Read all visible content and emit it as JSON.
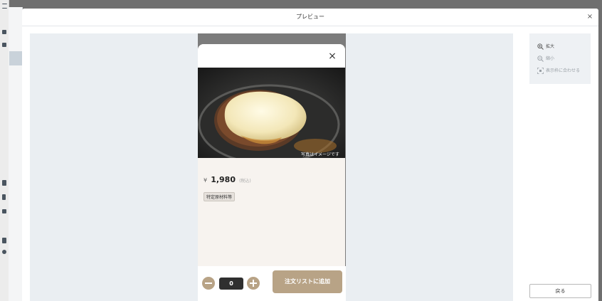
{
  "modal": {
    "title": "プレビュー",
    "close_icon": "×"
  },
  "product": {
    "close_icon": "×",
    "image_caption": "写真はイメージです",
    "price_currency": "¥",
    "price_value": "1,980",
    "price_tax": "(税込)",
    "allergen_tag": "特定原材料等"
  },
  "cart": {
    "quantity": "0",
    "add_label": "注文リストに追加"
  },
  "zoom": {
    "zoom_in_label": "拡大",
    "zoom_out_label": "縮小",
    "fit_label": "表示枠に合わせる"
  },
  "footer": {
    "back_label": "戻る"
  },
  "colors": {
    "accent": "#b8a386",
    "quantity_bg": "#2f2f2f",
    "preview_bg": "#eaeef2"
  }
}
